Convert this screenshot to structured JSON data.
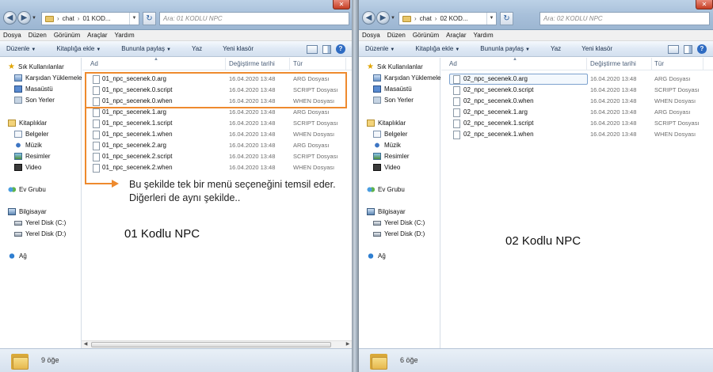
{
  "left": {
    "breadcrumb": [
      "chat",
      "01 KOD..."
    ],
    "search_placeholder": "Ara: 01 KODLU NPC",
    "menu": [
      "Dosya",
      "Düzen",
      "Görünüm",
      "Araçlar",
      "Yardım"
    ],
    "toolbar": {
      "organize": "Düzenle",
      "include": "Kitaplığa ekle",
      "share": "Bununla paylaş",
      "burn": "Yaz",
      "new_folder": "Yeni klasör"
    },
    "columns": {
      "name": "Ad",
      "date": "Değiştirme tarihi",
      "type": "Tür"
    },
    "files": [
      {
        "name": "01_npc_secenek.0.arg",
        "date": "16.04.2020 13:48",
        "type": "ARG Dosyası"
      },
      {
        "name": "01_npc_secenek.0.script",
        "date": "16.04.2020 13:48",
        "type": "SCRIPT Dosyası"
      },
      {
        "name": "01_npc_secenek.0.when",
        "date": "16.04.2020 13:48",
        "type": "WHEN Dosyası"
      },
      {
        "name": "01_npc_secenek.1.arg",
        "date": "16.04.2020 13:48",
        "type": "ARG Dosyası"
      },
      {
        "name": "01_npc_secenek.1.script",
        "date": "16.04.2020 13:48",
        "type": "SCRIPT Dosyası"
      },
      {
        "name": "01_npc_secenek.1.when",
        "date": "16.04.2020 13:48",
        "type": "WHEN Dosyası"
      },
      {
        "name": "01_npc_secenek.2.arg",
        "date": "16.04.2020 13:48",
        "type": "ARG Dosyası"
      },
      {
        "name": "01_npc_secenek.2.script",
        "date": "16.04.2020 13:48",
        "type": "SCRIPT Dosyası"
      },
      {
        "name": "01_npc_secenek.2.when",
        "date": "16.04.2020 13:48",
        "type": "WHEN Dosyası"
      }
    ],
    "status": "9 öğe"
  },
  "right": {
    "breadcrumb": [
      "chat",
      "02 KOD..."
    ],
    "search_placeholder": "Ara: 02 KODLU NPC",
    "menu": [
      "Dosya",
      "Düzen",
      "Görünüm",
      "Araçlar",
      "Yardım"
    ],
    "toolbar": {
      "organize": "Düzenle",
      "include": "Kitaplığa ekle",
      "share": "Bununla paylaş",
      "burn": "Yaz",
      "new_folder": "Yeni klasör"
    },
    "columns": {
      "name": "Ad",
      "date": "Değiştirme tarihi",
      "type": "Tür"
    },
    "files": [
      {
        "name": "02_npc_secenek.0.arg",
        "date": "16.04.2020 13:48",
        "type": "ARG Dosyası"
      },
      {
        "name": "02_npc_secenek.0.script",
        "date": "16.04.2020 13:48",
        "type": "SCRIPT Dosyası"
      },
      {
        "name": "02_npc_secenek.0.when",
        "date": "16.04.2020 13:48",
        "type": "WHEN Dosyası"
      },
      {
        "name": "02_npc_secenek.1.arg",
        "date": "16.04.2020 13:48",
        "type": "ARG Dosyası"
      },
      {
        "name": "02_npc_secenek.1.script",
        "date": "16.04.2020 13:48",
        "type": "SCRIPT Dosyası"
      },
      {
        "name": "02_npc_secenek.1.when",
        "date": "16.04.2020 13:48",
        "type": "WHEN Dosyası"
      }
    ],
    "status": "6 öğe"
  },
  "nav": {
    "favorites": "Sık Kullanılanlar",
    "downloads": "Karşıdan Yüklemeler",
    "desktop": "Masaüstü",
    "recent": "Son Yerler",
    "libraries": "Kitaplıklar",
    "documents": "Belgeler",
    "music": "Müzik",
    "pictures": "Resimler",
    "videos": "Video",
    "homegroup": "Ev Grubu",
    "computer": "Bilgisayar",
    "disk_c": "Yerel Disk (C:)",
    "disk_d": "Yerel Disk (D:)",
    "network": "Ağ"
  },
  "annotation": {
    "text": "Bu şekilde tek bir menü seçeneğini temsil eder. Diğerleri de aynı şekilde..",
    "label_left": "01 Kodlu NPC",
    "label_right": "02 Kodlu NPC",
    "color": "#ee8a2e"
  }
}
